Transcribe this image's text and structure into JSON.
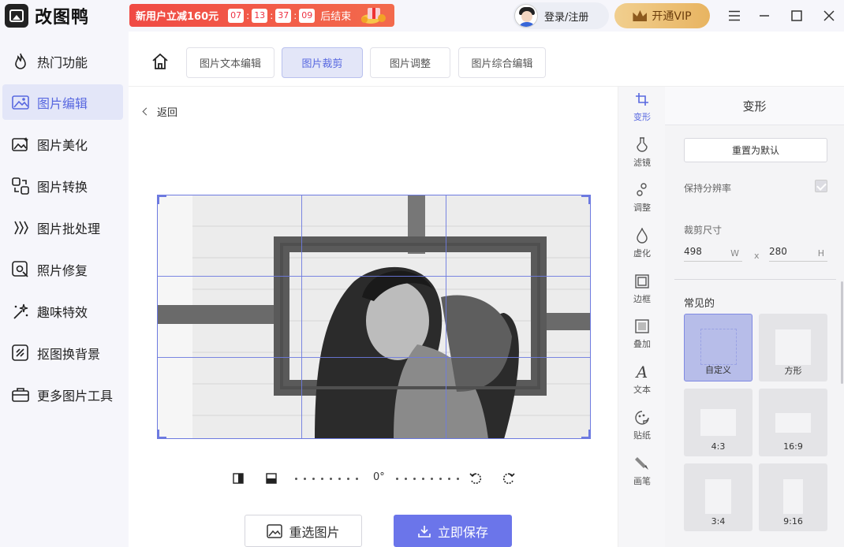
{
  "app": {
    "title": "改图鸭"
  },
  "promo": {
    "text": "新用户立减160元",
    "countdown": [
      "07",
      "13",
      "37",
      "09"
    ],
    "suffix": "后结束"
  },
  "user": {
    "label": "登录/注册"
  },
  "vip": {
    "label": "开通VIP"
  },
  "sidebar": {
    "items": [
      {
        "label": "热门功能",
        "icon": "fire-icon",
        "active": false
      },
      {
        "label": "图片编辑",
        "icon": "image-edit-icon",
        "active": true
      },
      {
        "label": "图片美化",
        "icon": "image-beautify-icon",
        "active": false
      },
      {
        "label": "图片转换",
        "icon": "convert-icon",
        "active": false
      },
      {
        "label": "图片批处理",
        "icon": "batch-icon",
        "active": false
      },
      {
        "label": "照片修复",
        "icon": "photo-repair-icon",
        "active": false
      },
      {
        "label": "趣味特效",
        "icon": "sparkle-icon",
        "active": false
      },
      {
        "label": "抠图换背景",
        "icon": "cutout-icon",
        "active": false
      },
      {
        "label": "更多图片工具",
        "icon": "toolbox-icon",
        "active": false
      }
    ]
  },
  "tabs": [
    {
      "label": "图片文本编辑",
      "active": false
    },
    {
      "label": "图片裁剪",
      "active": true
    },
    {
      "label": "图片调整",
      "active": false
    },
    {
      "label": "图片综合编辑",
      "active": false
    }
  ],
  "canvas": {
    "back_label": "返回",
    "angle": "0°"
  },
  "actions": {
    "reselect_label": "重选图片",
    "save_label": "立即保存"
  },
  "tools": [
    {
      "label": "变形",
      "icon": "crop-icon",
      "active": true
    },
    {
      "label": "滤镜",
      "icon": "filter-icon",
      "active": false
    },
    {
      "label": "调整",
      "icon": "adjust-icon",
      "active": false
    },
    {
      "label": "虚化",
      "icon": "blur-icon",
      "active": false
    },
    {
      "label": "边框",
      "icon": "border-icon",
      "active": false
    },
    {
      "label": "叠加",
      "icon": "overlay-icon",
      "active": false
    },
    {
      "label": "文本",
      "icon": "text-icon",
      "active": false
    },
    {
      "label": "贴纸",
      "icon": "sticker-icon",
      "active": false
    },
    {
      "label": "画笔",
      "icon": "brush-icon",
      "active": false
    }
  ],
  "panel": {
    "title": "变形",
    "reset_label": "重置为默认",
    "keep_resolution_label": "保持分辨率",
    "keep_resolution_checked": true,
    "crop_size_label": "裁剪尺寸",
    "width_value": "498",
    "width_unit": "W",
    "times": "x",
    "height_value": "280",
    "height_unit": "H",
    "common_label": "常见的",
    "presets": [
      {
        "label": "自定义",
        "active": true
      },
      {
        "label": "方形",
        "active": false
      },
      {
        "label": "4:3",
        "active": false
      },
      {
        "label": "16:9",
        "active": false
      },
      {
        "label": "3:4",
        "active": false
      },
      {
        "label": "9:16",
        "active": false
      }
    ]
  },
  "colors": {
    "accent": "#6b75ea",
    "sidebar_bg": "#f6f6fb",
    "promo": "#f04a44",
    "vip_gold": "#e8b461"
  }
}
